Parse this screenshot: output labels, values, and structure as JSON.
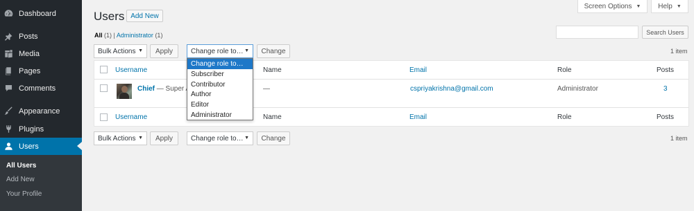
{
  "sidebar": {
    "items": [
      {
        "label": "Dashboard",
        "icon": "dashboard-icon"
      },
      {
        "label": "Posts",
        "icon": "pin-icon"
      },
      {
        "label": "Media",
        "icon": "media-icon"
      },
      {
        "label": "Pages",
        "icon": "pages-icon"
      },
      {
        "label": "Comments",
        "icon": "comment-icon"
      },
      {
        "label": "Appearance",
        "icon": "brush-icon"
      },
      {
        "label": "Plugins",
        "icon": "plug-icon"
      },
      {
        "label": "Users",
        "icon": "user-icon"
      }
    ],
    "submenu": [
      "All Users",
      "Add New",
      "Your Profile"
    ]
  },
  "header": {
    "screen_options": "Screen Options",
    "help": "Help",
    "title": "Users",
    "add_new": "Add New"
  },
  "filters": {
    "all_label": "All",
    "all_count": "(1)",
    "separator": "|",
    "admin_label": "Administrator",
    "admin_count": "(1)"
  },
  "search": {
    "value": "",
    "button": "Search Users"
  },
  "bulk": {
    "bulk_actions": "Bulk Actions",
    "apply": "Apply",
    "change_role": "Change role to…",
    "change": "Change",
    "items_count": "1 item"
  },
  "table": {
    "columns": [
      "Username",
      "Name",
      "Email",
      "Role",
      "Posts"
    ],
    "rows": [
      {
        "username": "Chief",
        "role_suffix": "— Super A",
        "name": "—",
        "email": "cspriyakrishna@gmail.com",
        "role": "Administrator",
        "posts": "3"
      }
    ]
  },
  "dropdown": {
    "options": [
      "Change role to…",
      "Subscriber",
      "Contributor",
      "Author",
      "Editor",
      "Administrator"
    ],
    "selected": "Change role to…"
  },
  "colors": {
    "sidebar_bg": "#23282d",
    "accent": "#0073aa",
    "page_bg": "#f1f1f1"
  }
}
